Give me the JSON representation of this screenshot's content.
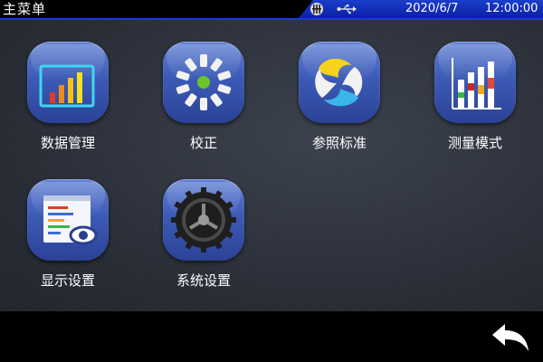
{
  "header": {
    "title": "主菜单",
    "date": "2020/6/7",
    "time": "12:00:00",
    "icons": [
      "device-icon",
      "usb-icon"
    ]
  },
  "apps": [
    {
      "label": "数据管理",
      "icon": "bar-chart-icon"
    },
    {
      "label": "校正",
      "icon": "calibration-dial-icon"
    },
    {
      "label": "参照标准",
      "icon": "reference-standard-icon"
    },
    {
      "label": "测量模式",
      "icon": "measure-mode-chart-icon"
    },
    {
      "label": "显示设置",
      "icon": "display-settings-icon"
    },
    {
      "label": "系统设置",
      "icon": "gear-icon"
    }
  ],
  "footer": {
    "back_icon": "back-arrow-icon"
  },
  "colors": {
    "status_bar_accent": "#1b3fc9",
    "icon_background": "#3c5bb6",
    "background": "#262a33"
  }
}
